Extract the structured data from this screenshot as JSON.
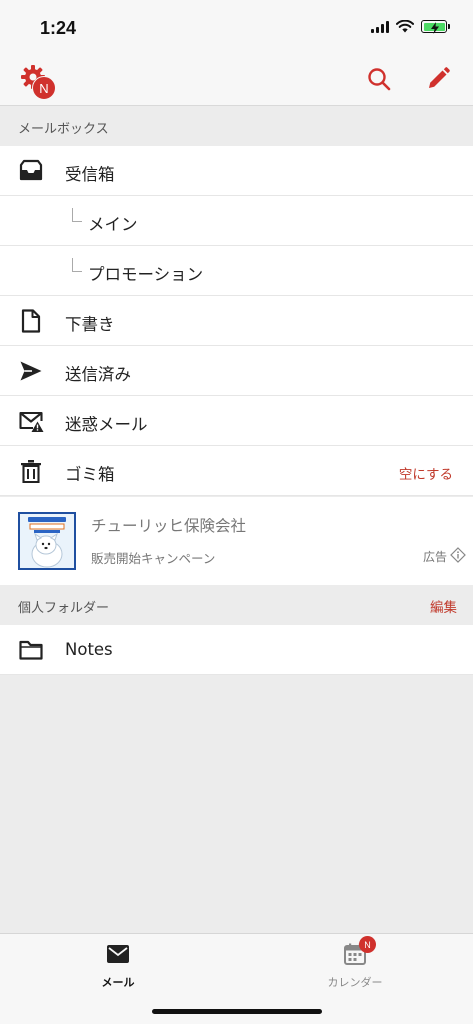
{
  "status_bar": {
    "time": "1:24"
  },
  "header": {
    "settings_badge": "N",
    "icons": {
      "settings": "gear-icon",
      "search": "search-icon",
      "compose": "pencil-icon"
    },
    "accent_color": "#d0312d"
  },
  "mailbox_section": {
    "title": "メールボックス",
    "items": [
      {
        "label": "受信箱",
        "icon": "inbox-icon"
      },
      {
        "label": "メイン",
        "icon": "subfolder-connector"
      },
      {
        "label": "プロモーション",
        "icon": "subfolder-connector"
      },
      {
        "label": "下書き",
        "icon": "document-icon"
      },
      {
        "label": "送信済み",
        "icon": "send-icon"
      },
      {
        "label": "迷惑メール",
        "icon": "spam-icon"
      },
      {
        "label": "ゴミ箱",
        "icon": "trash-icon",
        "action": "空にする"
      }
    ]
  },
  "ad": {
    "title": "チューリッヒ保険会社",
    "subtitle": "販売開始キャンペーン",
    "badge": "広告"
  },
  "personal_section": {
    "title": "個人フォルダー",
    "action": "編集",
    "items": [
      {
        "label": "Notes",
        "icon": "folder-icon"
      }
    ]
  },
  "tab_bar": {
    "tabs": [
      {
        "label": "メール",
        "icon": "mail-icon",
        "active": true
      },
      {
        "label": "カレンダー",
        "icon": "calendar-icon",
        "badge": "N"
      }
    ]
  }
}
